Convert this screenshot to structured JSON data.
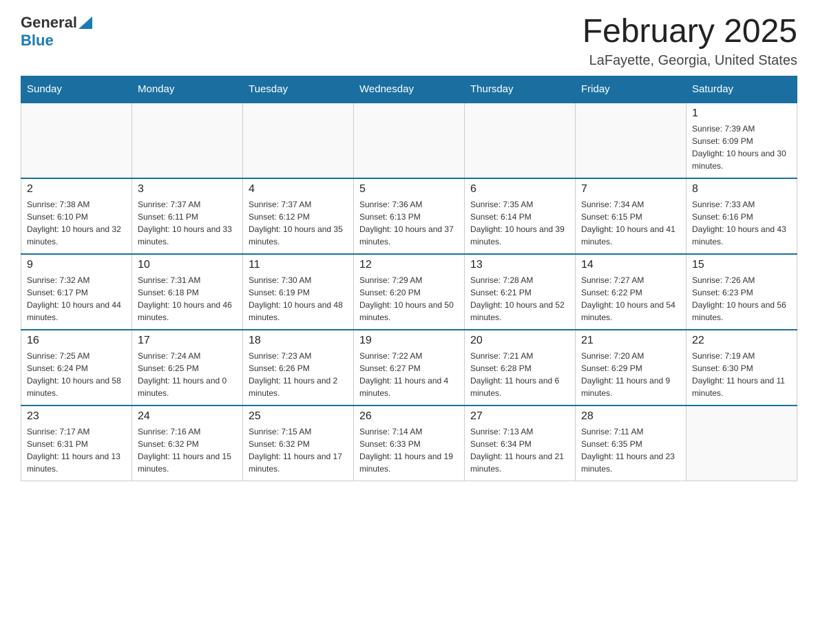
{
  "header": {
    "logo_general": "General",
    "logo_blue": "Blue",
    "month_title": "February 2025",
    "location": "LaFayette, Georgia, United States"
  },
  "days_of_week": [
    "Sunday",
    "Monday",
    "Tuesday",
    "Wednesday",
    "Thursday",
    "Friday",
    "Saturday"
  ],
  "weeks": [
    [
      {
        "day": "",
        "sunrise": "",
        "sunset": "",
        "daylight": ""
      },
      {
        "day": "",
        "sunrise": "",
        "sunset": "",
        "daylight": ""
      },
      {
        "day": "",
        "sunrise": "",
        "sunset": "",
        "daylight": ""
      },
      {
        "day": "",
        "sunrise": "",
        "sunset": "",
        "daylight": ""
      },
      {
        "day": "",
        "sunrise": "",
        "sunset": "",
        "daylight": ""
      },
      {
        "day": "",
        "sunrise": "",
        "sunset": "",
        "daylight": ""
      },
      {
        "day": "1",
        "sunrise": "Sunrise: 7:39 AM",
        "sunset": "Sunset: 6:09 PM",
        "daylight": "Daylight: 10 hours and 30 minutes."
      }
    ],
    [
      {
        "day": "2",
        "sunrise": "Sunrise: 7:38 AM",
        "sunset": "Sunset: 6:10 PM",
        "daylight": "Daylight: 10 hours and 32 minutes."
      },
      {
        "day": "3",
        "sunrise": "Sunrise: 7:37 AM",
        "sunset": "Sunset: 6:11 PM",
        "daylight": "Daylight: 10 hours and 33 minutes."
      },
      {
        "day": "4",
        "sunrise": "Sunrise: 7:37 AM",
        "sunset": "Sunset: 6:12 PM",
        "daylight": "Daylight: 10 hours and 35 minutes."
      },
      {
        "day": "5",
        "sunrise": "Sunrise: 7:36 AM",
        "sunset": "Sunset: 6:13 PM",
        "daylight": "Daylight: 10 hours and 37 minutes."
      },
      {
        "day": "6",
        "sunrise": "Sunrise: 7:35 AM",
        "sunset": "Sunset: 6:14 PM",
        "daylight": "Daylight: 10 hours and 39 minutes."
      },
      {
        "day": "7",
        "sunrise": "Sunrise: 7:34 AM",
        "sunset": "Sunset: 6:15 PM",
        "daylight": "Daylight: 10 hours and 41 minutes."
      },
      {
        "day": "8",
        "sunrise": "Sunrise: 7:33 AM",
        "sunset": "Sunset: 6:16 PM",
        "daylight": "Daylight: 10 hours and 43 minutes."
      }
    ],
    [
      {
        "day": "9",
        "sunrise": "Sunrise: 7:32 AM",
        "sunset": "Sunset: 6:17 PM",
        "daylight": "Daylight: 10 hours and 44 minutes."
      },
      {
        "day": "10",
        "sunrise": "Sunrise: 7:31 AM",
        "sunset": "Sunset: 6:18 PM",
        "daylight": "Daylight: 10 hours and 46 minutes."
      },
      {
        "day": "11",
        "sunrise": "Sunrise: 7:30 AM",
        "sunset": "Sunset: 6:19 PM",
        "daylight": "Daylight: 10 hours and 48 minutes."
      },
      {
        "day": "12",
        "sunrise": "Sunrise: 7:29 AM",
        "sunset": "Sunset: 6:20 PM",
        "daylight": "Daylight: 10 hours and 50 minutes."
      },
      {
        "day": "13",
        "sunrise": "Sunrise: 7:28 AM",
        "sunset": "Sunset: 6:21 PM",
        "daylight": "Daylight: 10 hours and 52 minutes."
      },
      {
        "day": "14",
        "sunrise": "Sunrise: 7:27 AM",
        "sunset": "Sunset: 6:22 PM",
        "daylight": "Daylight: 10 hours and 54 minutes."
      },
      {
        "day": "15",
        "sunrise": "Sunrise: 7:26 AM",
        "sunset": "Sunset: 6:23 PM",
        "daylight": "Daylight: 10 hours and 56 minutes."
      }
    ],
    [
      {
        "day": "16",
        "sunrise": "Sunrise: 7:25 AM",
        "sunset": "Sunset: 6:24 PM",
        "daylight": "Daylight: 10 hours and 58 minutes."
      },
      {
        "day": "17",
        "sunrise": "Sunrise: 7:24 AM",
        "sunset": "Sunset: 6:25 PM",
        "daylight": "Daylight: 11 hours and 0 minutes."
      },
      {
        "day": "18",
        "sunrise": "Sunrise: 7:23 AM",
        "sunset": "Sunset: 6:26 PM",
        "daylight": "Daylight: 11 hours and 2 minutes."
      },
      {
        "day": "19",
        "sunrise": "Sunrise: 7:22 AM",
        "sunset": "Sunset: 6:27 PM",
        "daylight": "Daylight: 11 hours and 4 minutes."
      },
      {
        "day": "20",
        "sunrise": "Sunrise: 7:21 AM",
        "sunset": "Sunset: 6:28 PM",
        "daylight": "Daylight: 11 hours and 6 minutes."
      },
      {
        "day": "21",
        "sunrise": "Sunrise: 7:20 AM",
        "sunset": "Sunset: 6:29 PM",
        "daylight": "Daylight: 11 hours and 9 minutes."
      },
      {
        "day": "22",
        "sunrise": "Sunrise: 7:19 AM",
        "sunset": "Sunset: 6:30 PM",
        "daylight": "Daylight: 11 hours and 11 minutes."
      }
    ],
    [
      {
        "day": "23",
        "sunrise": "Sunrise: 7:17 AM",
        "sunset": "Sunset: 6:31 PM",
        "daylight": "Daylight: 11 hours and 13 minutes."
      },
      {
        "day": "24",
        "sunrise": "Sunrise: 7:16 AM",
        "sunset": "Sunset: 6:32 PM",
        "daylight": "Daylight: 11 hours and 15 minutes."
      },
      {
        "day": "25",
        "sunrise": "Sunrise: 7:15 AM",
        "sunset": "Sunset: 6:32 PM",
        "daylight": "Daylight: 11 hours and 17 minutes."
      },
      {
        "day": "26",
        "sunrise": "Sunrise: 7:14 AM",
        "sunset": "Sunset: 6:33 PM",
        "daylight": "Daylight: 11 hours and 19 minutes."
      },
      {
        "day": "27",
        "sunrise": "Sunrise: 7:13 AM",
        "sunset": "Sunset: 6:34 PM",
        "daylight": "Daylight: 11 hours and 21 minutes."
      },
      {
        "day": "28",
        "sunrise": "Sunrise: 7:11 AM",
        "sunset": "Sunset: 6:35 PM",
        "daylight": "Daylight: 11 hours and 23 minutes."
      },
      {
        "day": "",
        "sunrise": "",
        "sunset": "",
        "daylight": ""
      }
    ]
  ]
}
